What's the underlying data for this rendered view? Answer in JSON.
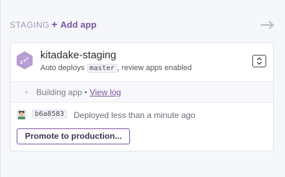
{
  "stage": {
    "name": "STAGING",
    "add_app_label": "Add app",
    "add_icon": "plus-icon",
    "move_icon": "arrow-right-icon"
  },
  "app": {
    "name": "kitadake-staging",
    "avatar_icon": "sleeping-zzz-icon",
    "sub_prefix": "Auto deploys",
    "branch": "master",
    "sub_suffix": ", review apps enabled",
    "expand_icon": "chevron-up-down-icon"
  },
  "build": {
    "status": "Building app",
    "separator": "•",
    "view_log_label": "View log"
  },
  "deploy": {
    "commit": "b6a8583",
    "text": "Deployed less than a minute ago",
    "promote_label": "Promote to production..."
  },
  "colors": {
    "accent": "#79589f",
    "avatar": "#b69dd3"
  }
}
